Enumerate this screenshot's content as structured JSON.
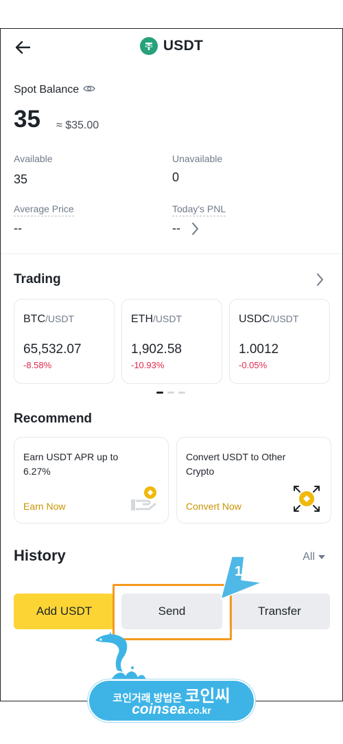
{
  "header": {
    "title": "USDT",
    "back_icon": "arrow-left-icon",
    "coin_icon": "tether-icon",
    "coin_color": "#26a17b"
  },
  "balance": {
    "label": "Spot Balance",
    "eye_icon": "eye-icon",
    "amount": "35",
    "approx_usd": "≈ $35.00"
  },
  "stats": {
    "available_label": "Available",
    "available_value": "35",
    "unavailable_label": "Unavailable",
    "unavailable_value": "0",
    "avg_price_label": "Average Price",
    "avg_price_value": "--",
    "pnl_label": "Today's PNL",
    "pnl_value": "--"
  },
  "trading": {
    "title": "Trading",
    "pairs": [
      {
        "base": "BTC",
        "quote": "/USDT",
        "price": "65,532.07",
        "change": "-8.58%"
      },
      {
        "base": "ETH",
        "quote": "/USDT",
        "price": "1,902.58",
        "change": "-10.93%"
      },
      {
        "base": "USDC",
        "quote": "/USDT",
        "price": "1.0012",
        "change": "-0.05%"
      }
    ],
    "page_count": 3,
    "active_page": 0
  },
  "recommend": {
    "title": "Recommend",
    "cards": [
      {
        "text": "Earn USDT APR up to 6.27%",
        "cta": "Earn Now",
        "icon": "earn-icon"
      },
      {
        "text": "Convert USDT to Other Crypto",
        "cta": "Convert Now",
        "icon": "convert-icon"
      }
    ]
  },
  "history": {
    "title": "History",
    "filter": "All"
  },
  "actions": {
    "add": "Add USDT",
    "send": "Send",
    "transfer": "Transfer"
  },
  "annotation": {
    "step_number": "1",
    "highlight_color": "#f39a1e",
    "arrow_color": "#4fb8e6"
  },
  "watermark": {
    "line1_small": "코인거래 방법은",
    "line1_big": "코인씨",
    "line2_main": "coinsea",
    "line2_suffix": ".co.kr",
    "color": "#3eb4e6"
  },
  "colors": {
    "accent": "#fcd535",
    "negative": "#e0294a",
    "gold_text": "#c99400"
  }
}
